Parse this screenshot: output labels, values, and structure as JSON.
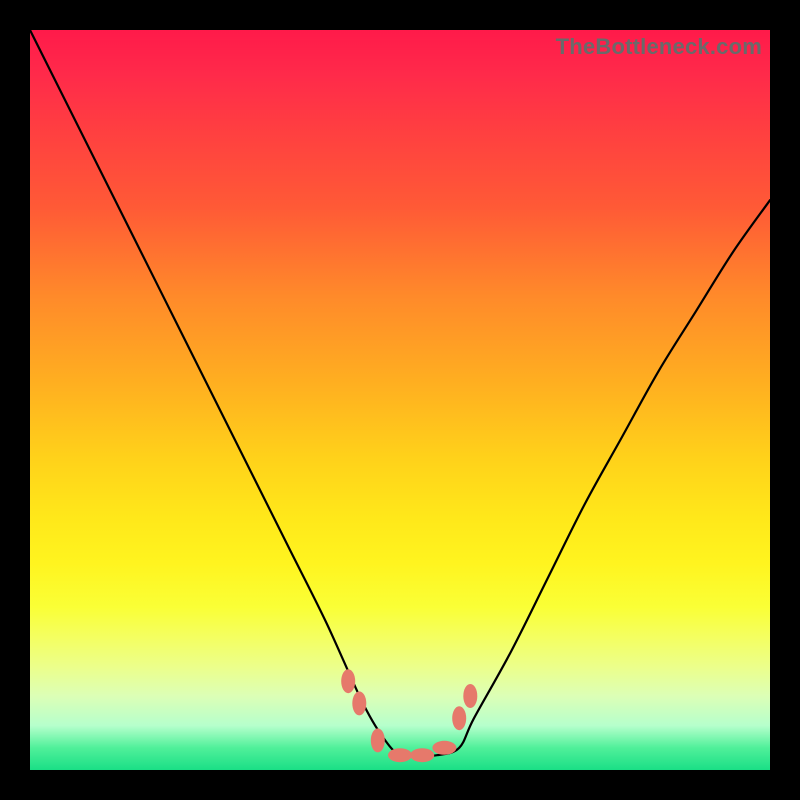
{
  "watermark": "TheBottleneck.com",
  "colors": {
    "border": "#000000",
    "gradient_top": "#ff1a4a",
    "gradient_bottom": "#1adf86",
    "marker": "#e6796b",
    "curve": "#000000"
  },
  "chart_data": {
    "type": "line",
    "title": "",
    "xlabel": "",
    "ylabel": "",
    "xlim": [
      0,
      100
    ],
    "ylim": [
      0,
      100
    ],
    "grid": false,
    "legend": false,
    "series": [
      {
        "name": "bottleneck-curve",
        "x": [
          0,
          5,
          10,
          15,
          20,
          25,
          30,
          35,
          40,
          45,
          48,
          50,
          52,
          55,
          58,
          60,
          65,
          70,
          75,
          80,
          85,
          90,
          95,
          100
        ],
        "y": [
          100,
          90,
          80,
          70,
          60,
          50,
          40,
          30,
          20,
          9,
          4,
          2,
          2,
          2,
          3,
          7,
          16,
          26,
          36,
          45,
          54,
          62,
          70,
          77
        ]
      }
    ],
    "markers": {
      "name": "highlight-points",
      "x": [
        43,
        44.5,
        47,
        50,
        53,
        56,
        58,
        59.5
      ],
      "y": [
        12,
        9,
        4,
        2,
        2,
        3,
        7,
        10
      ]
    }
  }
}
